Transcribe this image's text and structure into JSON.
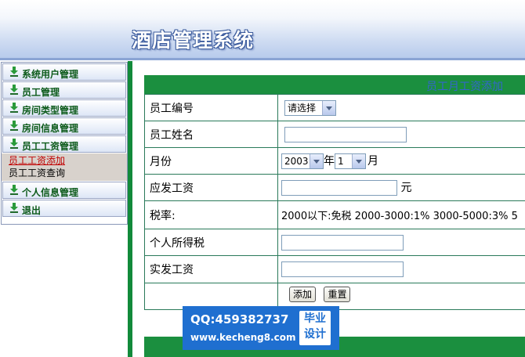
{
  "app": {
    "title": "酒店管理系统"
  },
  "sidebar": {
    "items": [
      {
        "label": "系统用户管理"
      },
      {
        "label": "员工管理"
      },
      {
        "label": "房间类型管理"
      },
      {
        "label": "房间信息管理"
      },
      {
        "label": "员工工资管理"
      },
      {
        "label": "个人信息管理"
      },
      {
        "label": "退出"
      }
    ],
    "submenu": [
      {
        "label": "员工工资添加"
      },
      {
        "label": "员工工资查询"
      }
    ]
  },
  "form": {
    "title": "员工月工资添加",
    "rows": {
      "employee_id": "员工编号",
      "employee_name": "员工姓名",
      "month": "月份",
      "gross_pay": "应发工资",
      "tax_rate": "税率:",
      "income_tax": "个人所得税",
      "net_pay": "实发工资"
    },
    "employee_select": "请选择",
    "year_select": "2003",
    "year_unit": "年",
    "month_select": "1",
    "month_unit": "月",
    "currency_unit": "元",
    "tax_rate_text": "2000以下:免税  2000-3000:1% 3000-5000:3% 5",
    "add_button": "添加",
    "reset_button": "重置"
  },
  "watermark": {
    "qq": "QQ:459382737",
    "url": "www.kecheng8.com",
    "badge_line1": "毕业",
    "badge_line2": "设计"
  },
  "colors": {
    "accent_green": "#1b8f3f",
    "header_blue": "#b7cbec",
    "link_red": "#c00000"
  }
}
